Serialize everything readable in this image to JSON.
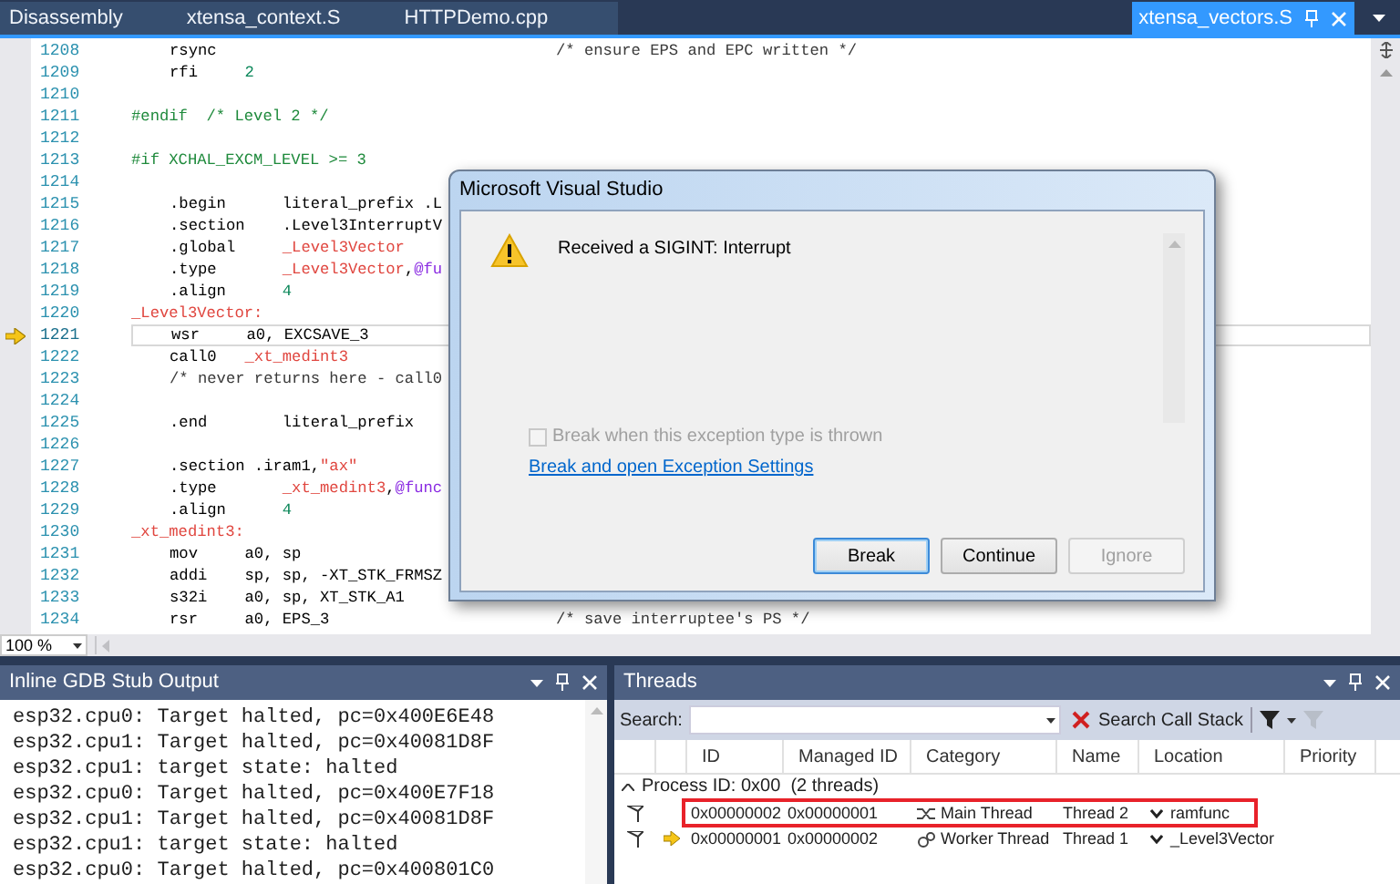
{
  "tabs": [
    {
      "label": "Disassembly",
      "kind": "document",
      "selected": false
    },
    {
      "label": "xtensa_context.S",
      "kind": "document",
      "selected": false
    },
    {
      "label": "HTTPDemo.cpp",
      "kind": "document",
      "selected": false
    },
    {
      "label": "xtensa_vectors.S",
      "kind": "preview",
      "selected": true
    }
  ],
  "editor": {
    "zoom": "100 %",
    "lines": [
      {
        "number": "1208",
        "kind": "instr",
        "current": false,
        "tokens": [
          {
            "text": "rsync",
            "kind": "plain"
          }
        ],
        "comment": "/* ensure EPS and EPC written */"
      },
      {
        "number": "1209",
        "kind": "instr",
        "current": false,
        "tokens": [
          {
            "text": "rfi     ",
            "kind": "plain"
          },
          {
            "text": "2",
            "kind": "num"
          }
        ]
      },
      {
        "number": "1210",
        "kind": "blank",
        "current": false
      },
      {
        "number": "1211",
        "kind": "label",
        "current": false,
        "tokens": [
          {
            "text": "#endif  /* Level 2 */",
            "kind": "pre"
          }
        ]
      },
      {
        "number": "1212",
        "kind": "blank",
        "current": false
      },
      {
        "number": "1213",
        "kind": "label",
        "current": false,
        "tokens": [
          {
            "text": "#if XCHAL_EXCM_LEVEL >= 3",
            "kind": "pre"
          }
        ]
      },
      {
        "number": "1214",
        "kind": "blank",
        "current": false
      },
      {
        "number": "1215",
        "kind": "instr",
        "current": false,
        "tokens": [
          {
            "text": ".begin      literal_prefix .L",
            "kind": "plain"
          }
        ]
      },
      {
        "number": "1216",
        "kind": "instr",
        "current": false,
        "tokens": [
          {
            "text": ".section    .Level3InterruptV",
            "kind": "plain"
          }
        ]
      },
      {
        "number": "1217",
        "kind": "instr",
        "current": false,
        "tokens": [
          {
            "text": ".global     ",
            "kind": "plain"
          },
          {
            "text": "_Level3Vector",
            "kind": "label"
          }
        ]
      },
      {
        "number": "1218",
        "kind": "instr",
        "current": false,
        "tokens": [
          {
            "text": ".type       ",
            "kind": "plain"
          },
          {
            "text": "_Level3Vector",
            "kind": "label"
          },
          {
            "text": ",",
            "kind": "plain"
          },
          {
            "text": "@fu",
            "kind": "attr"
          }
        ]
      },
      {
        "number": "1219",
        "kind": "instr",
        "current": false,
        "tokens": [
          {
            "text": ".align      ",
            "kind": "plain"
          },
          {
            "text": "4",
            "kind": "num"
          }
        ]
      },
      {
        "number": "1220",
        "kind": "label",
        "current": false,
        "tokens": [
          {
            "text": "_Level3Vector:",
            "kind": "label"
          }
        ]
      },
      {
        "number": "1221",
        "kind": "instr",
        "current": true,
        "tokens": [
          {
            "text": "wsr     a0, EXCSAVE_3",
            "kind": "plain"
          }
        ]
      },
      {
        "number": "1222",
        "kind": "instr",
        "current": false,
        "tokens": [
          {
            "text": "call0   ",
            "kind": "plain"
          },
          {
            "text": "_xt_medint3",
            "kind": "label"
          }
        ]
      },
      {
        "number": "1223",
        "kind": "instr",
        "current": false,
        "tokens": [
          {
            "text": "/* never returns here - call0",
            "kind": "comment"
          }
        ]
      },
      {
        "number": "1224",
        "kind": "blank",
        "current": false
      },
      {
        "number": "1225",
        "kind": "instr",
        "current": false,
        "tokens": [
          {
            "text": ".end        literal_prefix",
            "kind": "plain"
          }
        ]
      },
      {
        "number": "1226",
        "kind": "blank",
        "current": false
      },
      {
        "number": "1227",
        "kind": "instr",
        "current": false,
        "tokens": [
          {
            "text": ".section .iram1,",
            "kind": "plain"
          },
          {
            "text": "\"ax\"",
            "kind": "label"
          }
        ]
      },
      {
        "number": "1228",
        "kind": "instr",
        "current": false,
        "tokens": [
          {
            "text": ".type       ",
            "kind": "plain"
          },
          {
            "text": "_xt_medint3",
            "kind": "label"
          },
          {
            "text": ",",
            "kind": "plain"
          },
          {
            "text": "@func",
            "kind": "attr"
          }
        ]
      },
      {
        "number": "1229",
        "kind": "instr",
        "current": false,
        "tokens": [
          {
            "text": ".align      ",
            "kind": "plain"
          },
          {
            "text": "4",
            "kind": "num"
          }
        ]
      },
      {
        "number": "1230",
        "kind": "label",
        "current": false,
        "tokens": [
          {
            "text": "_xt_medint3:",
            "kind": "label"
          }
        ]
      },
      {
        "number": "1231",
        "kind": "instr",
        "current": false,
        "tokens": [
          {
            "text": "mov     a0, sp",
            "kind": "plain"
          }
        ]
      },
      {
        "number": "1232",
        "kind": "instr",
        "current": false,
        "tokens": [
          {
            "text": "addi    sp, sp, -XT_STK_FRMSZ",
            "kind": "plain"
          }
        ]
      },
      {
        "number": "1233",
        "kind": "instr",
        "current": false,
        "tokens": [
          {
            "text": "s32i    a0, sp, XT_STK_A1",
            "kind": "plain"
          }
        ]
      },
      {
        "number": "1234",
        "kind": "instr",
        "current": false,
        "tokens": [
          {
            "text": "rsr     a0, EPS_3",
            "kind": "plain"
          }
        ],
        "comment": "/* save interruptee's PS */"
      }
    ]
  },
  "dialog": {
    "title": "Microsoft Visual Studio",
    "message": "Received a SIGINT: Interrupt",
    "checkbox": {
      "label": "Break when this exception type is thrown",
      "checked": false,
      "disabled": true
    },
    "link": "Break and open Exception Settings",
    "buttons": [
      {
        "label": "Break",
        "default": true,
        "disabled": false
      },
      {
        "label": "Continue",
        "default": false,
        "disabled": false
      },
      {
        "label": "Ignore",
        "default": false,
        "disabled": true
      }
    ]
  },
  "output": {
    "title": "Inline GDB Stub Output",
    "lines": [
      "esp32.cpu0: Target halted, pc=0x400E6E48",
      "esp32.cpu1: Target halted, pc=0x40081D8F",
      "esp32.cpu1: target state: halted",
      "esp32.cpu0: Target halted, pc=0x400E7F18",
      "esp32.cpu1: Target halted, pc=0x40081D8F",
      "esp32.cpu1: target state: halted",
      "esp32.cpu0: Target halted, pc=0x400801C0"
    ]
  },
  "threads": {
    "title": "Threads",
    "search_label": "Search:",
    "search_call_stack": "Search Call Stack",
    "columns": [
      "ID",
      "Managed ID",
      "Category",
      "Name",
      "Location",
      "Priority"
    ],
    "group": {
      "label": "Process ID: 0x00  (2 threads)",
      "expanded": true
    },
    "rows": [
      {
        "id": "0x00000002",
        "managed_id": "0x00000001",
        "category": "Main Thread",
        "kind": "main",
        "name": "Thread 2",
        "location": "ramfunc",
        "current": false,
        "highlighted": true
      },
      {
        "id": "0x00000001",
        "managed_id": "0x00000002",
        "category": "Worker Thread",
        "kind": "worker",
        "name": "Thread 1",
        "location": "_Level3Vector",
        "current": true,
        "highlighted": false
      }
    ]
  }
}
